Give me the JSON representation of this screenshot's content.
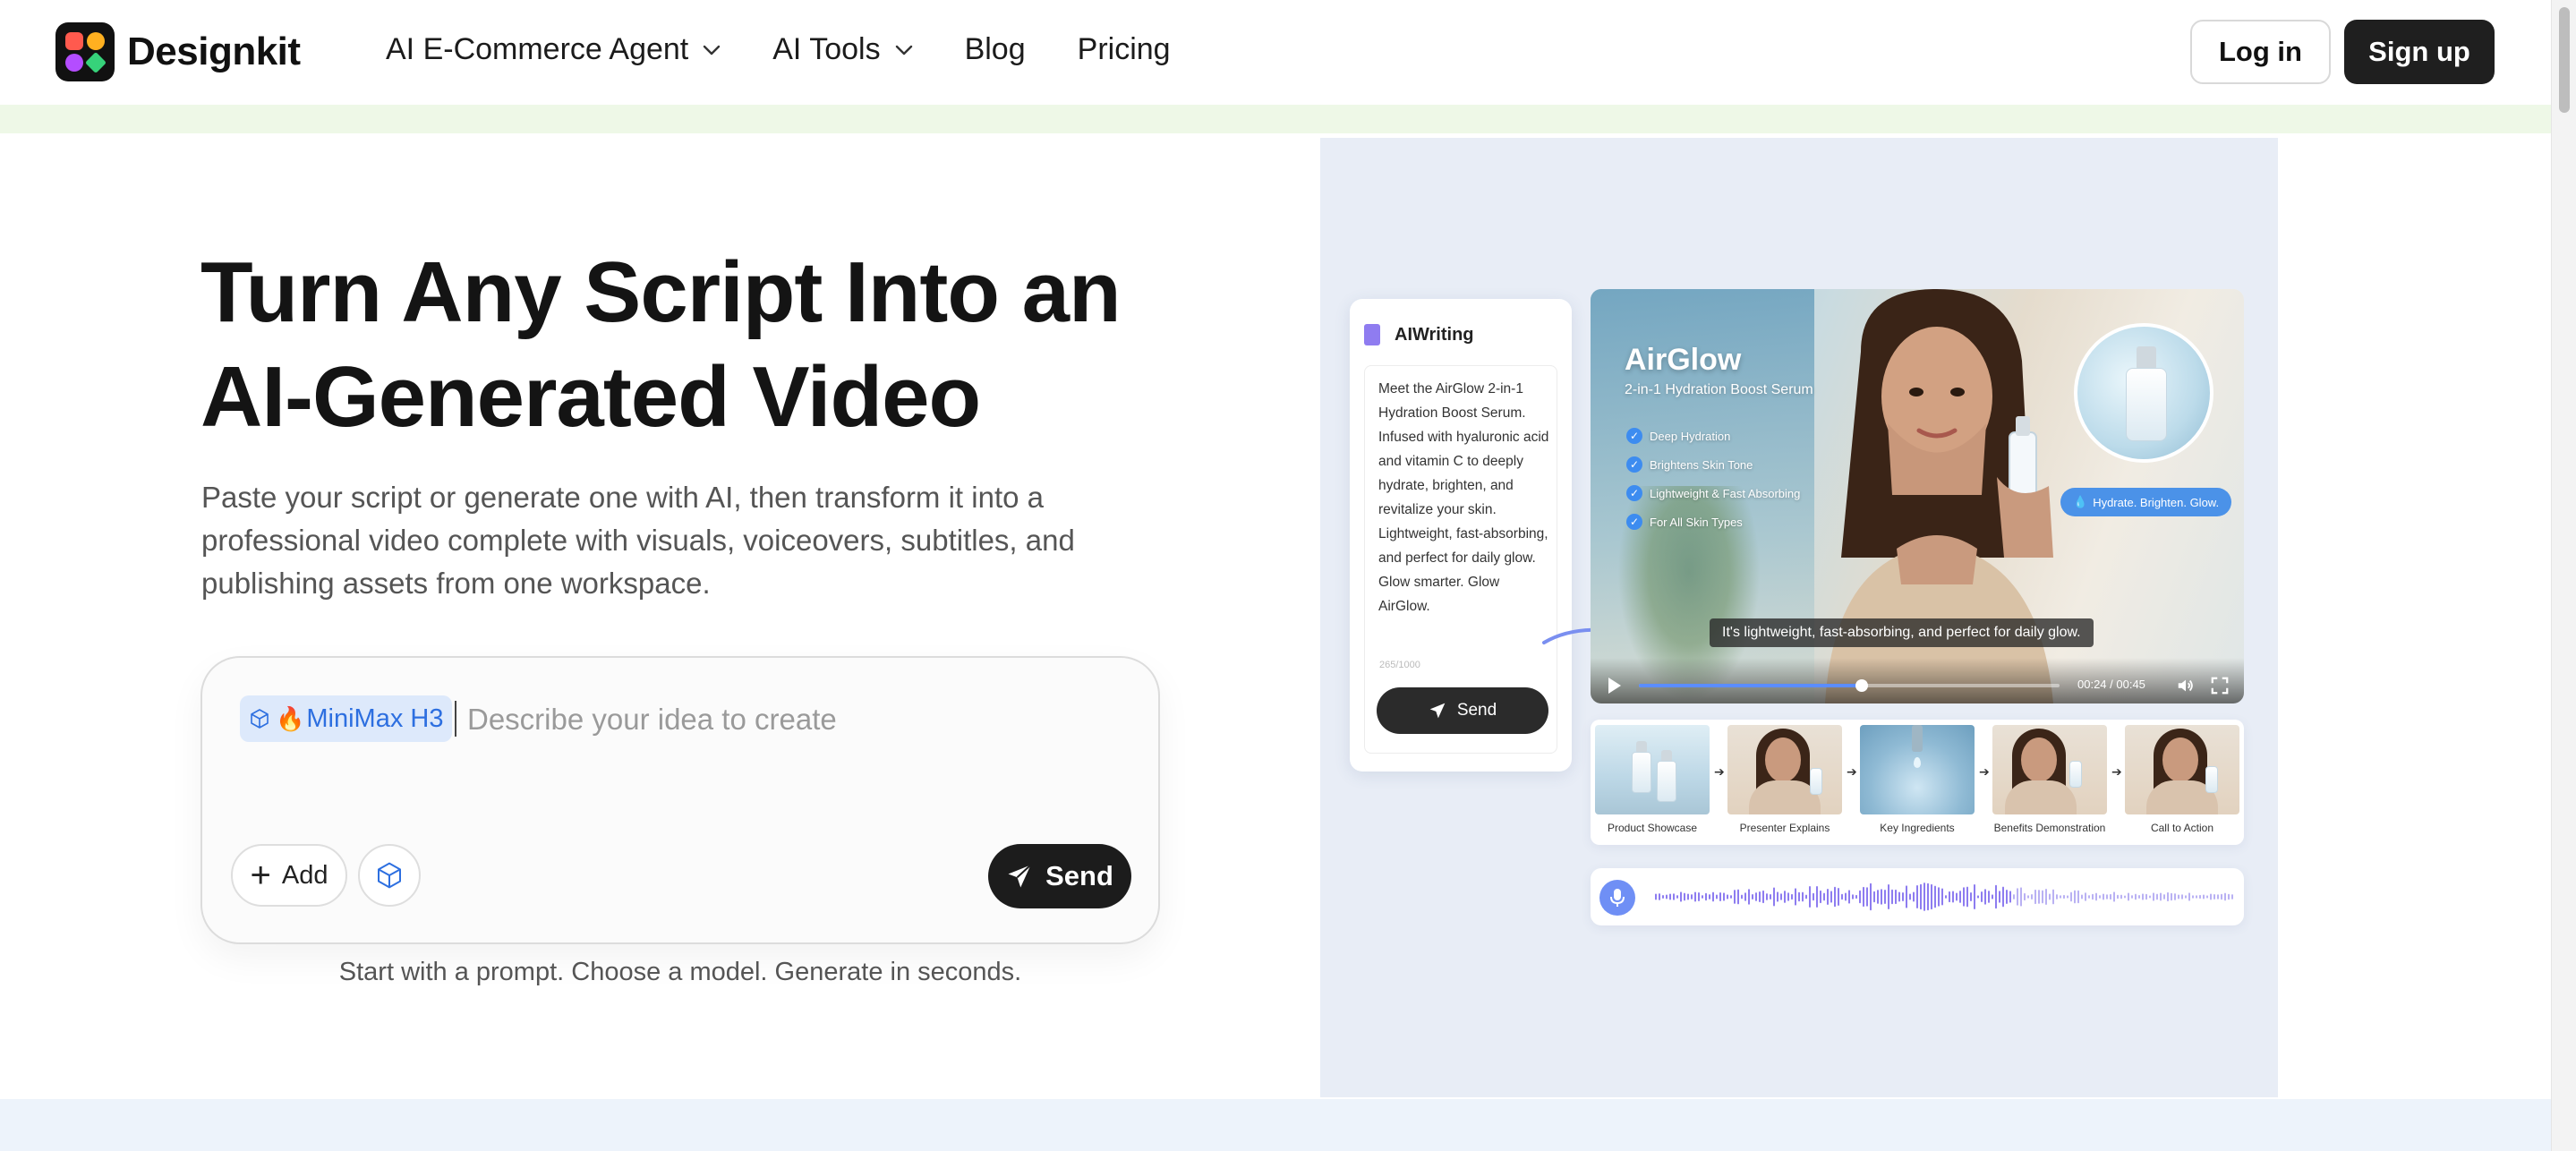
{
  "nav": {
    "brand": "Designkit",
    "menu": [
      {
        "label": "AI E-Commerce Agent",
        "has_dropdown": true
      },
      {
        "label": "AI Tools",
        "has_dropdown": true
      },
      {
        "label": "Blog",
        "has_dropdown": false
      },
      {
        "label": "Pricing",
        "has_dropdown": false
      }
    ],
    "login_label": "Log in",
    "signup_label": "Sign up"
  },
  "hero": {
    "title": "Turn Any Script Into an AI-Generated Video",
    "subtitle": "Paste your script or generate one with AI, then transform it into a professional video complete with visuals, voiceovers, subtitles, and publishing assets from one workspace.",
    "prompt": {
      "model_chip": "MiniMax H3",
      "model_chip_icon": "fire-icon",
      "placeholder": "Describe your idea to create",
      "value": "",
      "add_label": "Add",
      "send_label": "Send",
      "hint": "Start with a prompt. Choose a model. Generate in seconds."
    }
  },
  "illustration": {
    "ai_writing": {
      "title": "AIWriting",
      "script": "Meet the AirGlow 2-in-1 Hydration Boost Serum. Infused with hyaluronic acid and vitamin C to deeply hydrate, brighten, and revitalize your skin. Lightweight, fast-absorbing, and perfect for daily glow. Glow smarter. Glow AirGlow.",
      "char_count": "265/1000",
      "send_label": "Send"
    },
    "video": {
      "brand": "AirGlow",
      "tagline": "2-in-1 Hydration Boost Serum",
      "benefits": [
        "Deep Hydration",
        "Brightens Skin Tone",
        "Lightweight & Fast Absorbing",
        "For All Skin Types"
      ],
      "badge": "Hydrate. Brighten. Glow.",
      "caption": "It's lightweight, fast-absorbing, and perfect for daily glow.",
      "time": "00:24 / 00:45",
      "progress": 0.53,
      "accent": "#5b8dff"
    },
    "storyboard": [
      {
        "label": "Product Showcase"
      },
      {
        "label": "Presenter Explains"
      },
      {
        "label": "Key Ingredients"
      },
      {
        "label": "Benefits Demonstration"
      },
      {
        "label": "Call to Action"
      }
    ]
  },
  "colors": {
    "primary_dark": "#1f1f1f",
    "chip_bg": "#dde9fb",
    "chip_text": "#2d6fe0",
    "top_strip": "#eef8e7",
    "illustration_bg": "#e8edf6"
  }
}
